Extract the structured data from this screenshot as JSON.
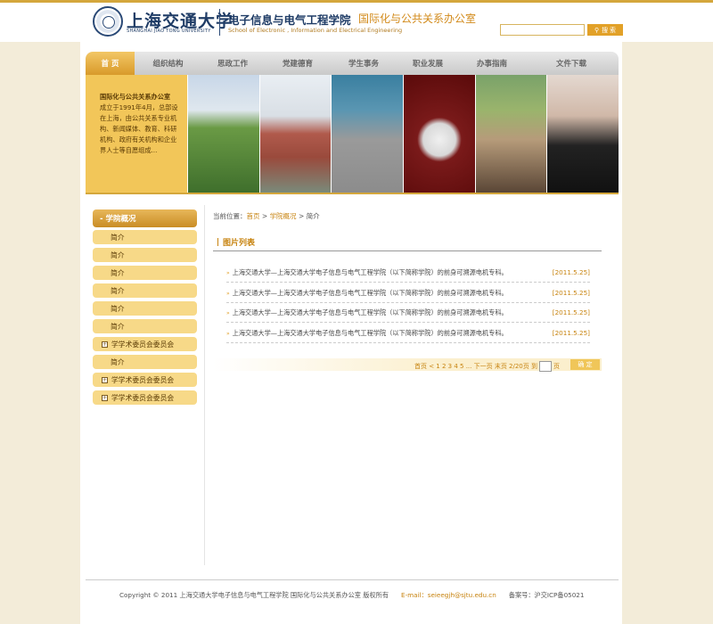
{
  "header": {
    "university_cn": "上海交通大学",
    "university_en": "SHANGHAI JIAO TONG UNIVERSITY",
    "school_cn": "电子信息与电气工程学院",
    "office_cn": "国际化与公共关系办公室",
    "school_en": "School of Electronic , Information and Electrical Engineering",
    "search_placeholder": "",
    "search_button": "搜 索"
  },
  "nav": {
    "items": [
      "首 页",
      "组织结构",
      "思政工作",
      "党建德育",
      "学生事务",
      "职业发展",
      "办事指南",
      "文件下载"
    ]
  },
  "banner": {
    "title": "国际化与公共关系办公室",
    "text": "成立于1991年4月，总部设在上海，由公共关系专业机构、新闻媒体、教育、科研机构、政府有关机构和企业界人士等自愿组成..."
  },
  "sidebar": {
    "header": "- 学院概况",
    "items": [
      {
        "label": "简介",
        "expandable": false
      },
      {
        "label": "简介",
        "expandable": false
      },
      {
        "label": "简介",
        "expandable": false
      },
      {
        "label": "简介",
        "expandable": false
      },
      {
        "label": "简介",
        "expandable": false
      },
      {
        "label": "简介",
        "expandable": false
      },
      {
        "label": "学学术委员会委员会",
        "expandable": true
      },
      {
        "label": "简介",
        "expandable": false
      },
      {
        "label": "学学术委员会委员会",
        "expandable": true
      },
      {
        "label": "学学术委员会委员会",
        "expandable": true
      }
    ]
  },
  "breadcrumb": {
    "prefix": "当前位置：",
    "home": "首页",
    "sep1": " > ",
    "section": "学院概况",
    "sep2": " > ",
    "current": "简介"
  },
  "list": {
    "title": "图片列表",
    "rows": [
      {
        "title": "上海交通大学—上海交通大学电子信息与电气工程学院（以下简称学院）的前身可溯源电机专科。",
        "date": "[2011.5.25]"
      },
      {
        "title": "上海交通大学—上海交通大学电子信息与电气工程学院（以下简称学院）的前身可溯源电机专科。",
        "date": "[2011.5.25]"
      },
      {
        "title": "上海交通大学—上海交通大学电子信息与电气工程学院（以下简称学院）的前身可溯源电机专科。",
        "date": "[2011.5.25]"
      },
      {
        "title": "上海交通大学—上海交通大学电子信息与电气工程学院（以下简称学院）的前身可溯源电机专科。",
        "date": "[2011.5.25]"
      }
    ]
  },
  "pager": {
    "text": "首页 < 1 2 3 4 5 ... 下一页 末页 2/20页 到",
    "suffix": "页",
    "confirm": "确 定"
  },
  "footer": {
    "copyright": "Copyright © 2011 上海交通大学电子信息与电气工程学院 国际化与公共关系办公室 版权所有",
    "email": "E-mail：seieegjh@sjtu.edu.cn",
    "icp": "备案号：沪交ICP备05021"
  },
  "colors": {
    "accent": "#d4a73c",
    "link": "#c7830f",
    "navy": "#1f3c66"
  }
}
